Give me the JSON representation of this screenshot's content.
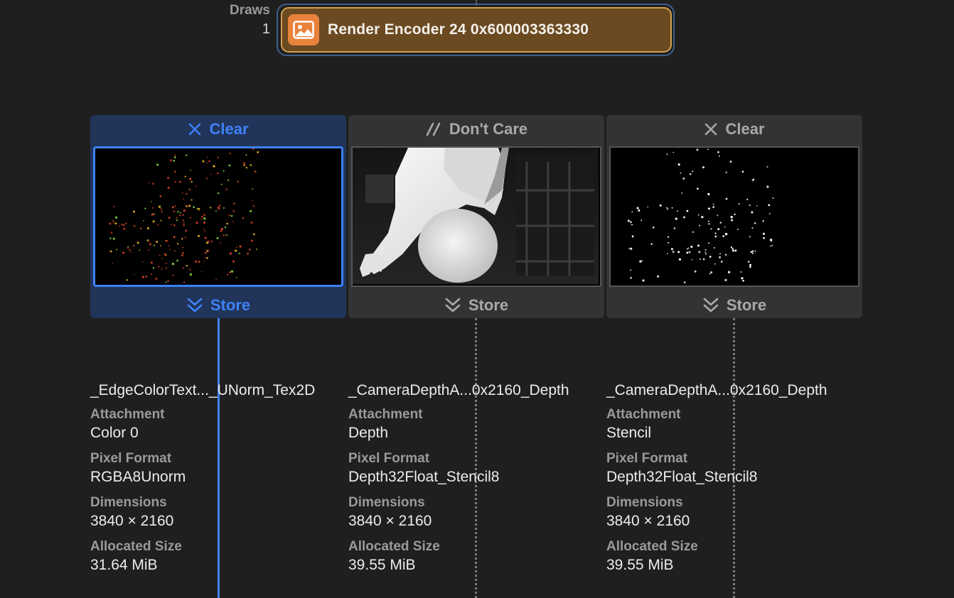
{
  "header": {
    "draws_label": "Draws",
    "draws_count": "1",
    "encoder_title": "Render Encoder 24 0x600003363330",
    "encoder_icon": "image-icon"
  },
  "colors": {
    "accent": "#3d82f6",
    "encoder_bg": "#6b4a22",
    "encoder_border": "#d2a052",
    "encoder_icon_bg": "#e8823c"
  },
  "attachments": [
    {
      "load_action": "Clear",
      "load_icon": "x-icon",
      "store_action": "Store",
      "store_icon": "double-chevron-down-icon",
      "selected": true,
      "name": "_EdgeColorText..._UNorm_Tex2D",
      "attachment_label": "Attachment",
      "attachment": "Color 0",
      "pixel_format_label": "Pixel Format",
      "pixel_format": "RGBA8Unorm",
      "dimensions_label": "Dimensions",
      "dimensions": "3840 × 2160",
      "allocated_size_label": "Allocated Size",
      "allocated_size": "31.64 MiB"
    },
    {
      "load_action": "Don't Care",
      "load_icon": "double-slash-icon",
      "store_action": "Store",
      "store_icon": "double-chevron-down-icon",
      "selected": false,
      "name": "_CameraDepthA...0x2160_Depth",
      "attachment_label": "Attachment",
      "attachment": "Depth",
      "pixel_format_label": "Pixel Format",
      "pixel_format": "Depth32Float_Stencil8",
      "dimensions_label": "Dimensions",
      "dimensions": "3840 × 2160",
      "allocated_size_label": "Allocated Size",
      "allocated_size": "39.55 MiB"
    },
    {
      "load_action": "Clear",
      "load_icon": "x-icon",
      "store_action": "Store",
      "store_icon": "double-chevron-down-icon",
      "selected": false,
      "name": "_CameraDepthA...0x2160_Depth",
      "attachment_label": "Attachment",
      "attachment": "Stencil",
      "pixel_format_label": "Pixel Format",
      "pixel_format": "Depth32Float_Stencil8",
      "dimensions_label": "Dimensions",
      "dimensions": "3840 × 2160",
      "allocated_size_label": "Allocated Size",
      "allocated_size": "39.55 MiB"
    }
  ]
}
